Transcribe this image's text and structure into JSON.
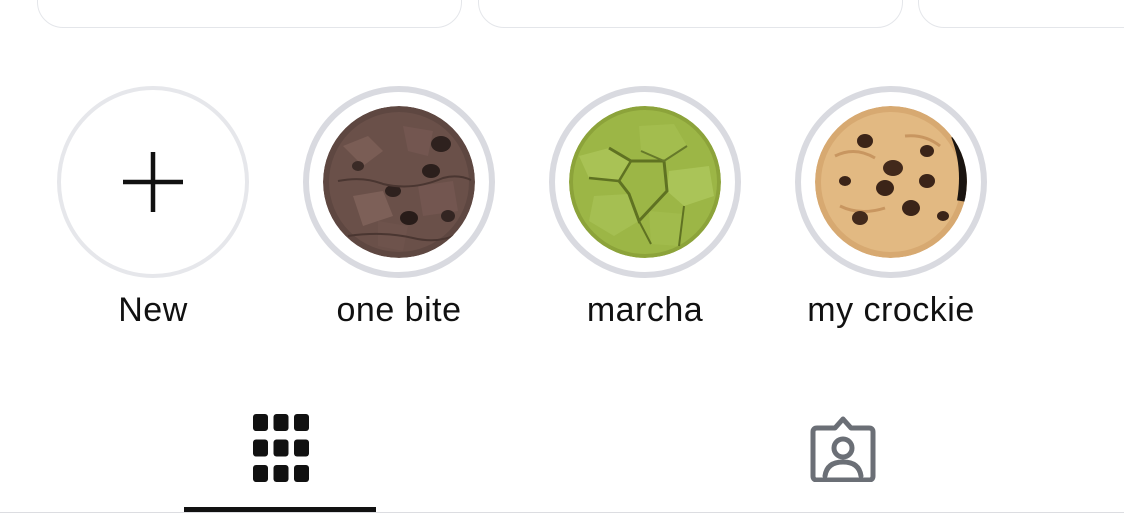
{
  "highlights": {
    "new": {
      "label": "New",
      "icon": "plus-icon"
    },
    "items": [
      {
        "label": "one bite",
        "thumb": "chocolate-cookie"
      },
      {
        "label": "marcha",
        "thumb": "matcha-cookie"
      },
      {
        "label": "my crockie",
        "thumb": "chocolate-chip-cookie"
      }
    ]
  },
  "tabs": [
    {
      "icon": "grid-icon",
      "selected": true
    },
    {
      "icon": "tagged-person-icon",
      "selected": false
    }
  ],
  "colors": {
    "ring": "#d9dae0",
    "text": "#111111",
    "tab_indicator": "#111111",
    "inactive_icon": "#6b6f76"
  }
}
